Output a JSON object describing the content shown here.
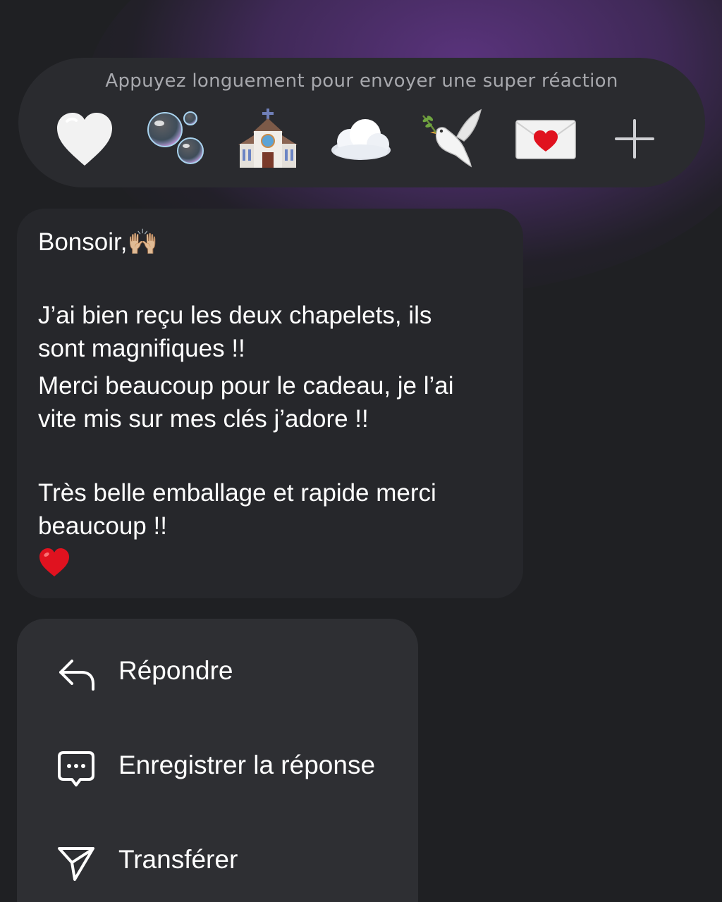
{
  "reactions": {
    "hint": "Appuyez longuement pour envoyer une super réaction",
    "items": [
      {
        "icon": "white-heart-icon"
      },
      {
        "icon": "bubbles-icon"
      },
      {
        "icon": "church-icon"
      },
      {
        "icon": "cloud-icon"
      },
      {
        "icon": "dove-icon"
      },
      {
        "icon": "love-letter-icon"
      },
      {
        "icon": "plus-icon"
      }
    ]
  },
  "message": {
    "lines": [
      "Bonsoir,🙌🏼",
      "J’ai bien reçu les deux chapelets, ils",
      "sont magnifiques !!",
      "Merci beaucoup pour le cadeau, je l’ai",
      "vite mis sur mes clés j’adore !!",
      "Très belle emballage et rapide merci",
      "beaucoup !!"
    ],
    "trailing_emoji": "red-heart-icon"
  },
  "menu": {
    "items": [
      {
        "label": "Répondre",
        "icon": "reply-arrow-icon"
      },
      {
        "label": "Enregistrer la réponse",
        "icon": "saved-reply-icon"
      },
      {
        "label": "Transférer",
        "icon": "paper-plane-icon"
      }
    ]
  },
  "colors": {
    "background": "#1f2023",
    "panel": "#2a2b2f",
    "bubble": "#26272b",
    "menu": "#2e2f33",
    "glow": "#5c3480",
    "text": "#ffffff",
    "hint_text": "#a7a8ad",
    "heart_red": "#e0121f"
  }
}
